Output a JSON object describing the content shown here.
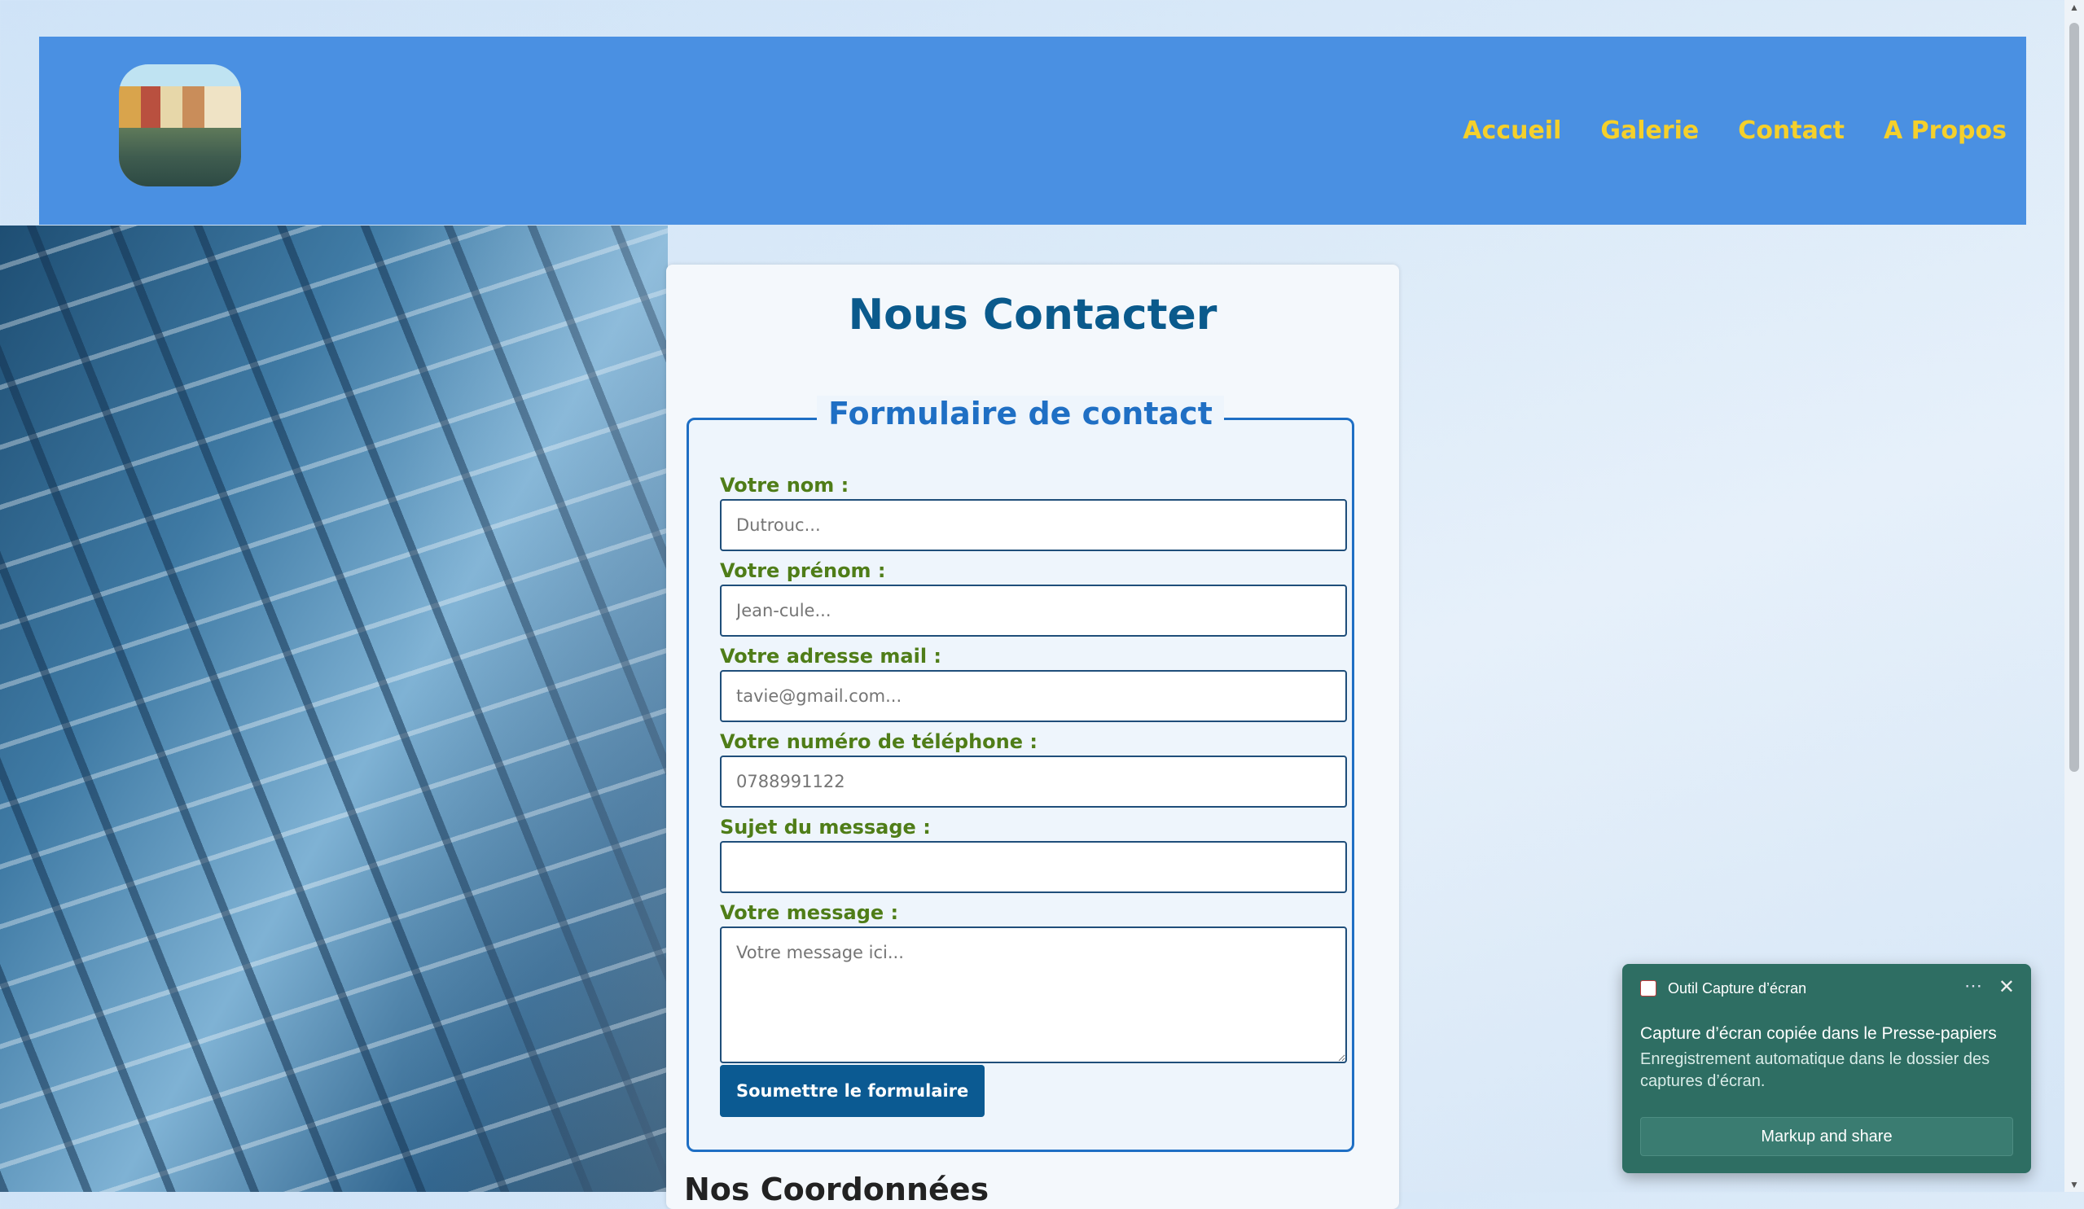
{
  "nav": {
    "items": [
      "Accueil",
      "Galerie",
      "Contact",
      "A Propos"
    ]
  },
  "page": {
    "title": "Nous Contacter",
    "next_heading": "Nos Coordonnées"
  },
  "form": {
    "legend": "Formulaire de contact",
    "fields": [
      {
        "label": "Votre nom :",
        "placeholder": "Dutrouc..."
      },
      {
        "label": "Votre prénom :",
        "placeholder": "Jean-cule..."
      },
      {
        "label": "Votre adresse mail :",
        "placeholder": "tavie@gmail.com..."
      },
      {
        "label": "Votre numéro de téléphone :",
        "placeholder": "0788991122"
      },
      {
        "label": "Sujet du message :",
        "placeholder": ""
      },
      {
        "label": "Votre message :",
        "placeholder": "Votre message ici..."
      }
    ],
    "submit_label": "Soumettre le formulaire"
  },
  "toast": {
    "app_name": "Outil Capture d’écran",
    "more_icon": "⋯",
    "close_icon": "✕",
    "title": "Capture d’écran copiée dans le Presse-papiers",
    "body": "Enregistrement automatique dans le dossier des captures d’écran.",
    "action_label": "Markup and share"
  },
  "colors": {
    "header_bg": "#4a90e2",
    "nav_link": "#f5d02b",
    "title": "#0a5a8c",
    "legend": "#1f6fc4",
    "label": "#4f7d18",
    "button": "#0b5a92",
    "toast_bg": "#2e6e63"
  }
}
